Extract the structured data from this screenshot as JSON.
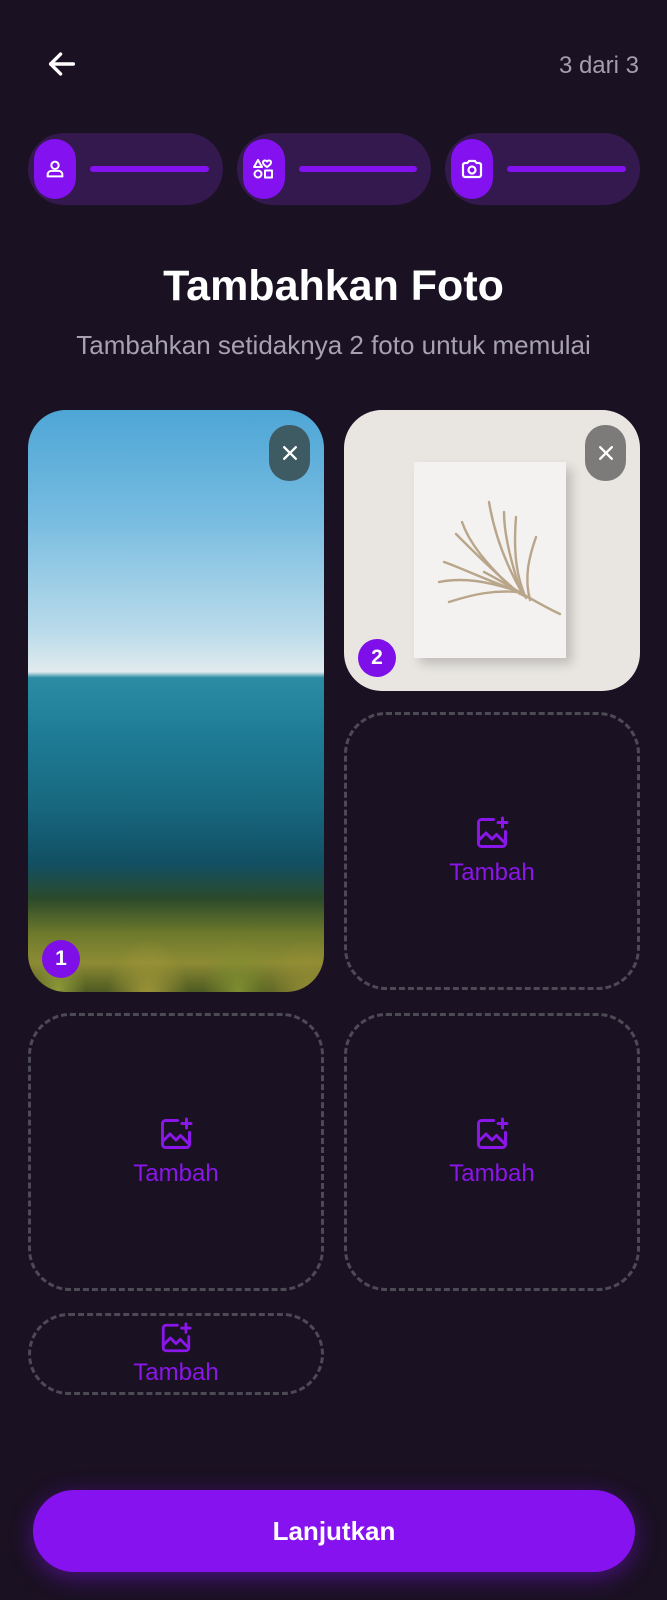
{
  "header": {
    "step_counter": "3 dari 3"
  },
  "steps": [
    {
      "icon": "person-icon"
    },
    {
      "icon": "shapes-icon"
    },
    {
      "icon": "camera-icon"
    }
  ],
  "title": "Tambahkan Foto",
  "subtitle": "Tambahkan setidaknya 2 foto untuk memulai",
  "photos": [
    {
      "index": "1"
    },
    {
      "index": "2"
    }
  ],
  "add_slots": [
    {
      "label": "Tambah"
    },
    {
      "label": "Tambah"
    },
    {
      "label": "Tambah"
    },
    {
      "label": "Tambah"
    }
  ],
  "continue_label": "Lanjutkan",
  "colors": {
    "background": "#1a1122",
    "accent": "#8612f0",
    "step_track": "#34194f"
  }
}
